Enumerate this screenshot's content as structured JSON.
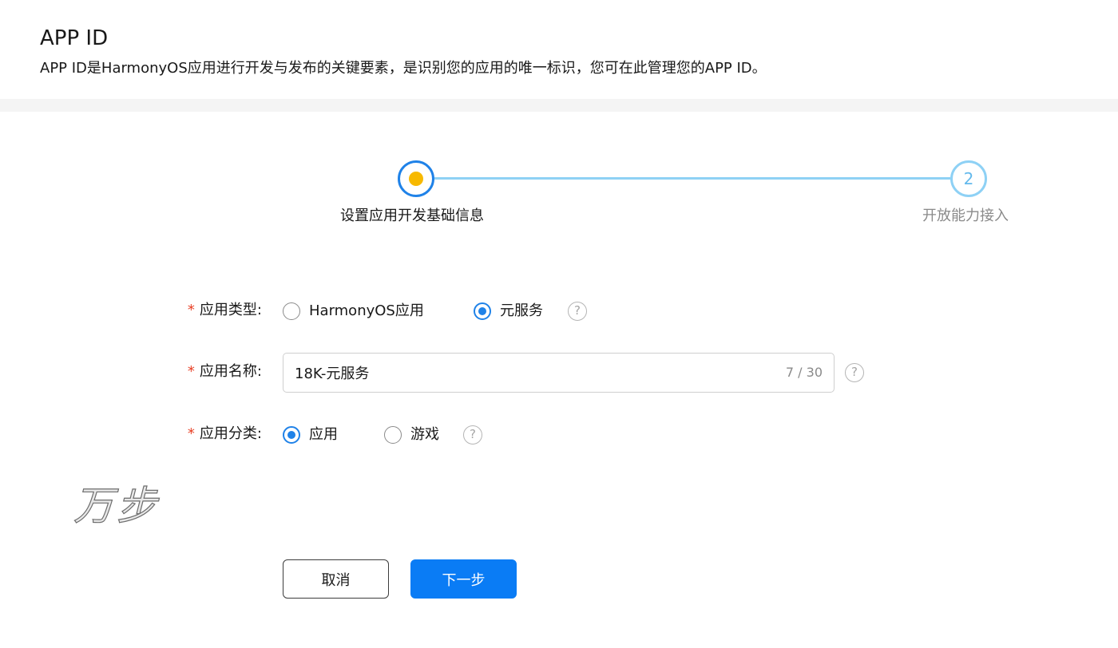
{
  "header": {
    "title": "APP ID",
    "description": "APP ID是HarmonyOS应用进行开发与发布的关键要素，是识别您的应用的唯一标识，您可在此管理您的APP ID。"
  },
  "steps": [
    {
      "label": "设置应用开发基础信息",
      "status": "active"
    },
    {
      "number": "2",
      "label": "开放能力接入",
      "status": "pending"
    }
  ],
  "form": {
    "required_mark": "*",
    "app_type": {
      "label": "应用类型:",
      "options": [
        {
          "label": "HarmonyOS应用",
          "checked": false
        },
        {
          "label": "元服务",
          "checked": true
        }
      ]
    },
    "app_name": {
      "label": "应用名称:",
      "value": "18K-元服务",
      "count": "7 / 30"
    },
    "app_category": {
      "label": "应用分类:",
      "options": [
        {
          "label": "应用",
          "checked": true
        },
        {
          "label": "游戏",
          "checked": false
        }
      ]
    },
    "help_glyph": "?"
  },
  "watermark": "万步",
  "buttons": {
    "cancel": "取消",
    "next": "下一步"
  },
  "colors": {
    "primary": "#0a7cf5",
    "step_active_border": "#1f82e8",
    "step_active_dot": "#f7b900",
    "step_pending": "#8ed1f5",
    "required": "#e84026"
  }
}
